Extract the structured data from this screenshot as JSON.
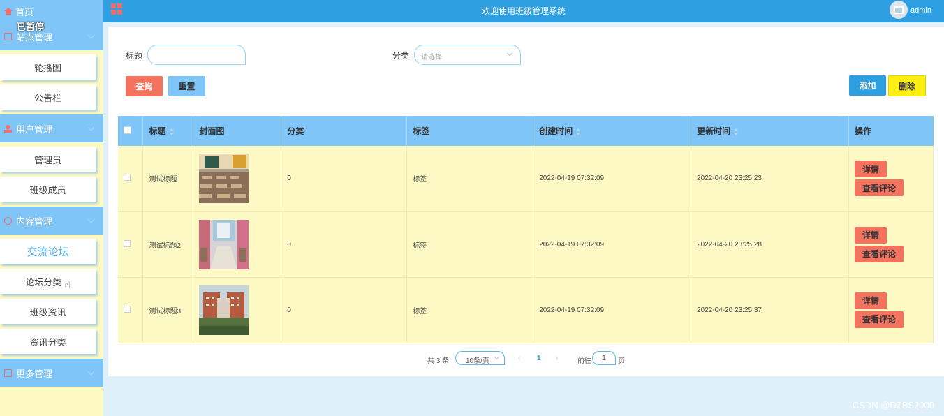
{
  "sidebar": {
    "home_label": "首页",
    "paused_text": "已暂停",
    "groups": [
      {
        "label": "站点管理",
        "items": [
          "轮播图",
          "公告栏"
        ]
      },
      {
        "label": "用户管理",
        "items": [
          "管理员",
          "班级成员"
        ]
      },
      {
        "label": "内容管理",
        "items": [
          "交流论坛",
          "论坛分类",
          "班级资讯",
          "资讯分类"
        ]
      },
      {
        "label": "更多管理",
        "items": []
      }
    ],
    "active_item": "交流论坛"
  },
  "topbar": {
    "title": "欢迎使用班级管理系统",
    "user": "admin"
  },
  "search": {
    "title_label": "标题",
    "title_value": "",
    "category_label": "分类",
    "category_placeholder": "请选择",
    "query_button": "查询",
    "reset_button": "重置",
    "add_button": "添加",
    "delete_button": "删除"
  },
  "table": {
    "headers": [
      "标题",
      "封面图",
      "分类",
      "标签",
      "创建时间",
      "更新时间",
      "操作"
    ],
    "rows": [
      {
        "title": "测试标题",
        "category": "0",
        "tag": "标签",
        "created": "2022-04-19 07:32:09",
        "updated": "2022-04-20 23:25:23"
      },
      {
        "title": "测试标题2",
        "category": "0",
        "tag": "标签",
        "created": "2022-04-19 07:32:09",
        "updated": "2022-04-20 23:25:28"
      },
      {
        "title": "测试标题3",
        "category": "0",
        "tag": "标签",
        "created": "2022-04-19 07:32:09",
        "updated": "2022-04-20 23:25:37"
      }
    ],
    "detail_button": "详情",
    "comments_button": "查看评论"
  },
  "pagination": {
    "total": "共 3 条",
    "page_size": "10条/页",
    "current_page": "1",
    "goto_label": "前往",
    "goto_value": "1",
    "page_suffix": "页"
  },
  "watermark": "CSDN @DZBS2000",
  "colors": {
    "topbar": "#2e9fe0",
    "sidebar_head": "#7fc5f7",
    "sidebar_bg": "#fdf9c4",
    "table_header": "#7fc5f7",
    "row_bg": "#fdf9c4",
    "danger": "#f4735f",
    "warn": "#ffee11"
  }
}
